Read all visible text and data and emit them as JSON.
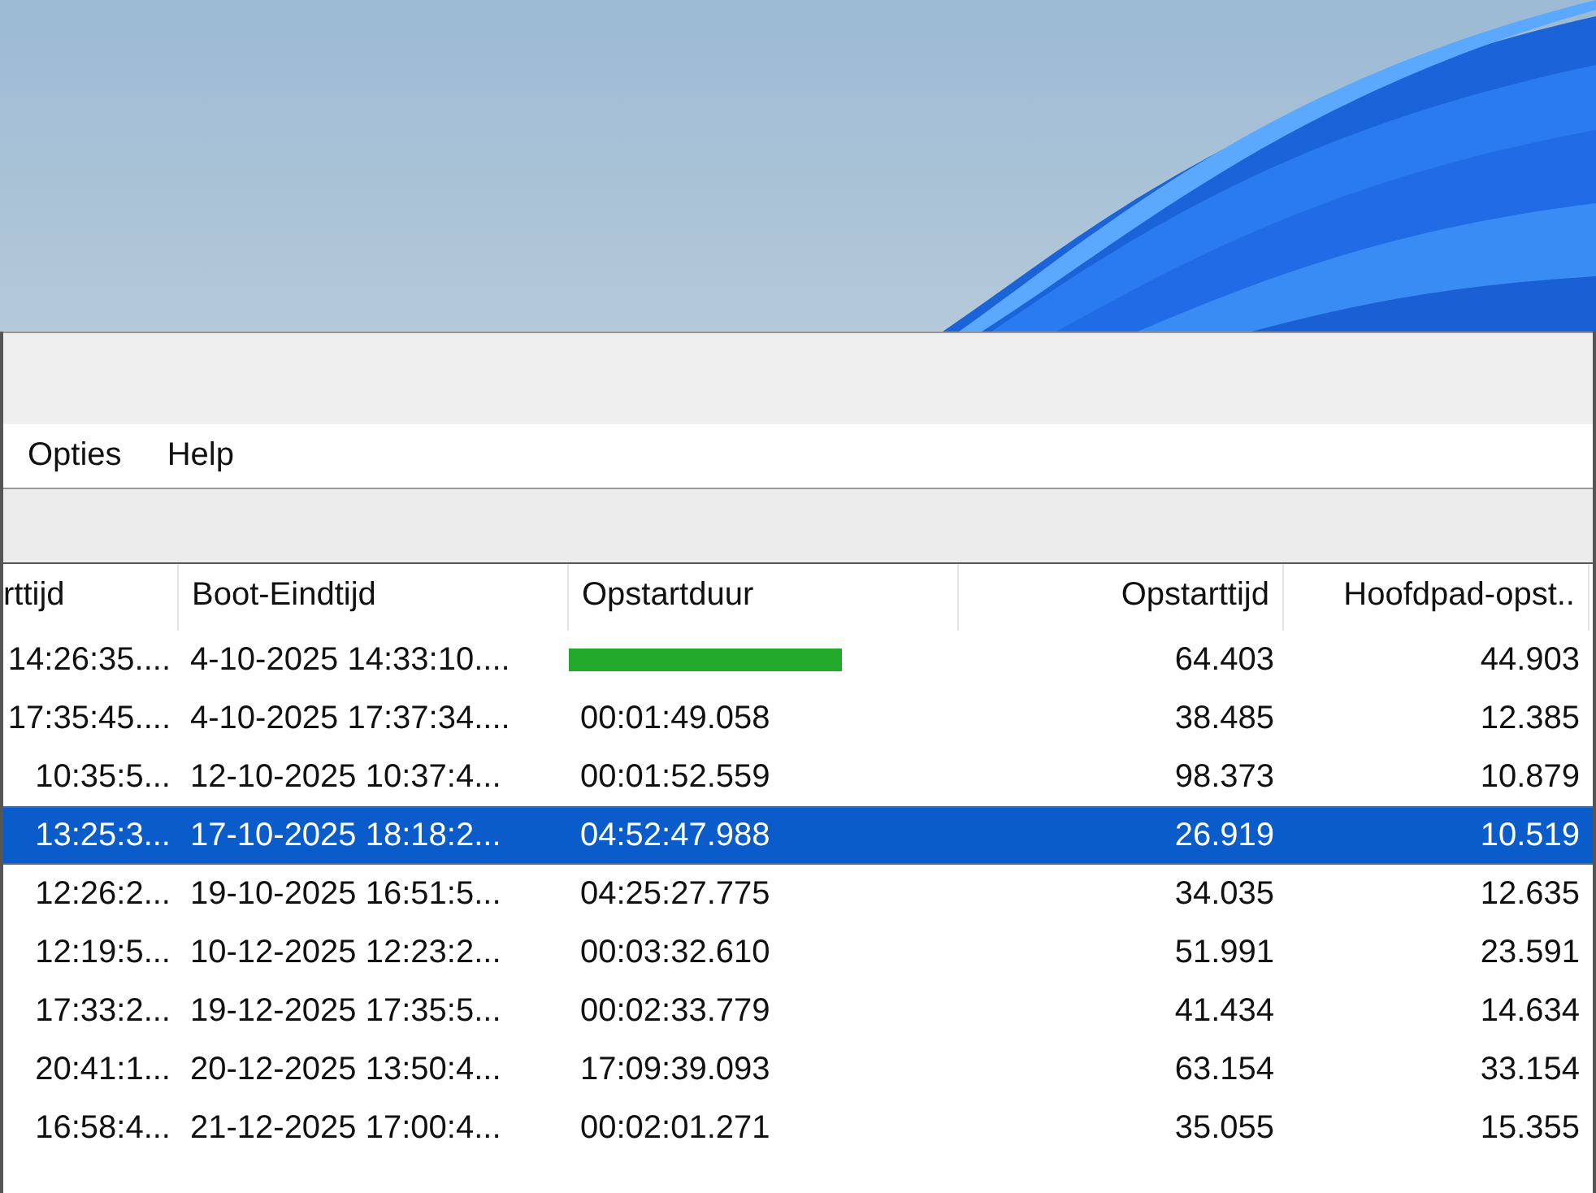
{
  "menu": [
    {
      "label": "Opties"
    },
    {
      "label": "Help"
    }
  ],
  "table": {
    "columns": [
      {
        "label": "rttijd",
        "kind": "clipped"
      },
      {
        "label": "Boot-Eindtijd",
        "kind": "text"
      },
      {
        "label": "Opstartduur",
        "kind": "text"
      },
      {
        "label": "Opstarttijd",
        "kind": "number"
      },
      {
        "label": "Hoofdpad-opst..",
        "kind": "number"
      }
    ],
    "rows": [
      {
        "selected": false,
        "cells": [
          "14:26:35....",
          "4-10-2025 14:33:10....",
          {
            "kind": "redaction"
          },
          "64.403",
          "44.903"
        ]
      },
      {
        "selected": false,
        "cells": [
          "17:35:45....",
          "4-10-2025 17:37:34....",
          "00:01:49.058",
          "38.485",
          "12.385"
        ]
      },
      {
        "selected": false,
        "cells": [
          "10:35:5...",
          "12-10-2025 10:37:4...",
          "00:01:52.559",
          "98.373",
          "10.879"
        ]
      },
      {
        "selected": true,
        "cells": [
          "13:25:3...",
          "17-10-2025 18:18:2...",
          "04:52:47.988",
          "26.919",
          "10.519"
        ]
      },
      {
        "selected": false,
        "cells": [
          "12:26:2...",
          "19-10-2025 16:51:5...",
          "04:25:27.775",
          "34.035",
          "12.635"
        ]
      },
      {
        "selected": false,
        "cells": [
          "12:19:5...",
          "10-12-2025 12:23:2...",
          "00:03:32.610",
          "51.991",
          "23.591"
        ]
      },
      {
        "selected": false,
        "cells": [
          "17:33:2...",
          "19-12-2025 17:35:5...",
          "00:02:33.779",
          "41.434",
          "14.634"
        ]
      },
      {
        "selected": false,
        "cells": [
          "20:41:1...",
          "20-12-2025 13:50:4...",
          "17:09:39.093",
          "63.154",
          "33.154"
        ]
      },
      {
        "selected": false,
        "cells": [
          "16:58:4...",
          "21-12-2025 17:00:4...",
          "00:02:01.271",
          "35.055",
          "15.355"
        ]
      }
    ]
  }
}
